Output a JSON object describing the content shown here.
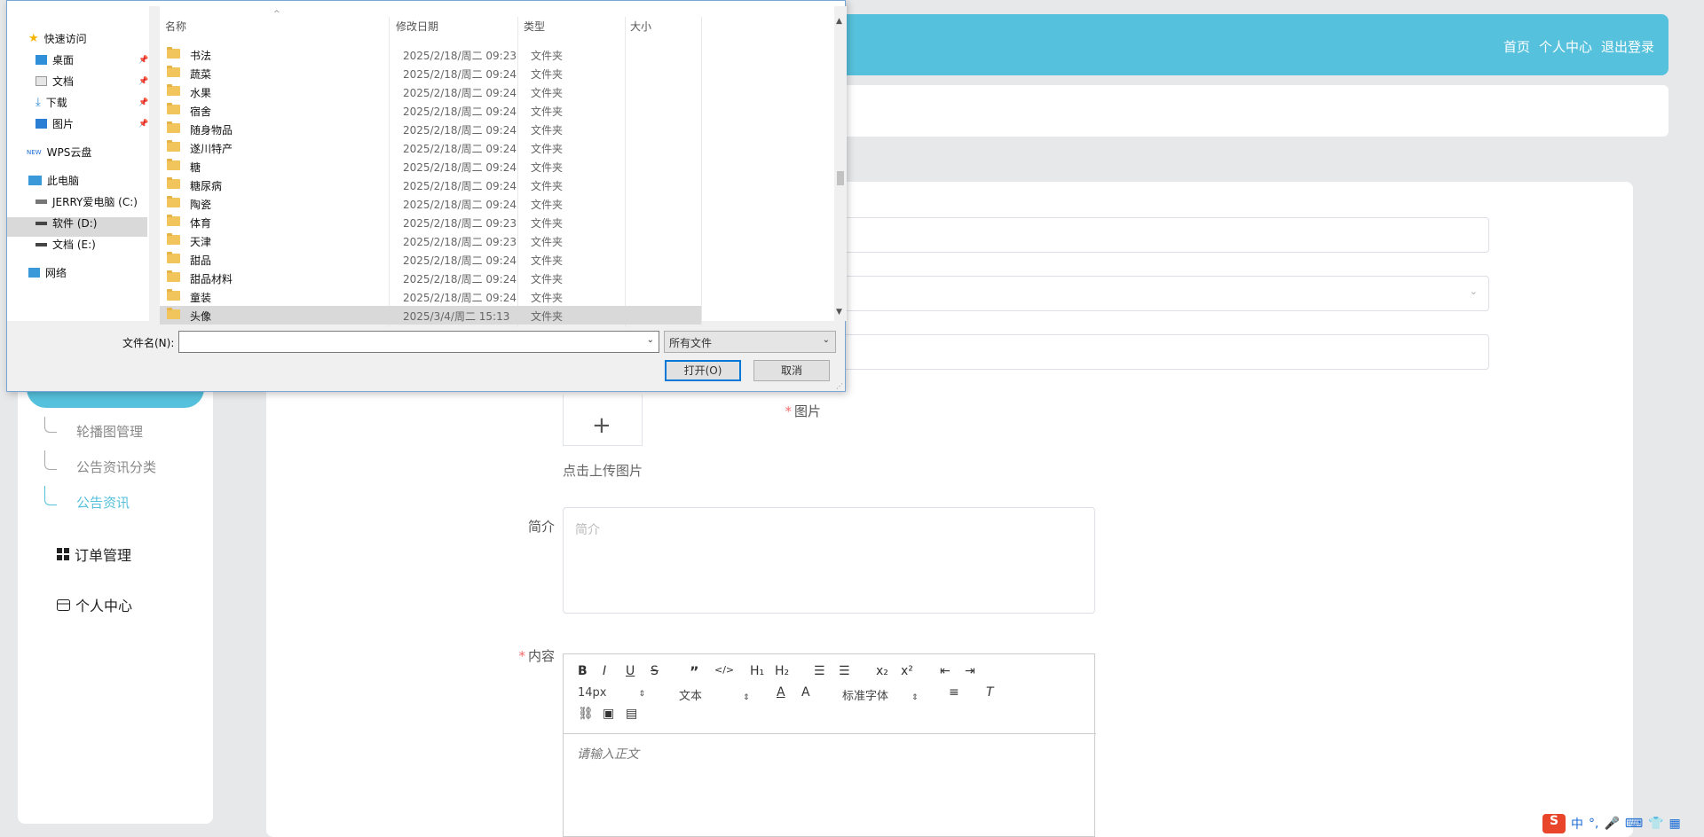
{
  "app": {
    "topnav": [
      "首页",
      "个人中心",
      "退出登录"
    ]
  },
  "sidebar": {
    "sub_items": [
      "轮播图管理",
      "公告资讯分类",
      "公告资讯"
    ],
    "menu": [
      "订单管理",
      "个人中心"
    ]
  },
  "form": {
    "image_label": "图片",
    "upload_tip": "点击上传图片",
    "intro_label": "简介",
    "intro_placeholder": "简介",
    "content_label": "内容",
    "editor": {
      "font_size": "14px",
      "heading": "文本",
      "font_family": "标准字体",
      "placeholder": "请输入正文"
    }
  },
  "dialog": {
    "nav": {
      "quick_access": "快速访问",
      "desktop": "桌面",
      "documents": "文档",
      "downloads": "下载",
      "pictures": "图片",
      "wps": "WPS云盘",
      "wps_badge": "NEW",
      "this_pc": "此电脑",
      "drive_c": "JERRY爱电脑 (C:)",
      "drive_d": "软件 (D:)",
      "drive_e": "文档 (E:)",
      "network": "网络"
    },
    "columns": [
      "名称",
      "修改日期",
      "类型",
      "大小"
    ],
    "rows": [
      {
        "name": "书法",
        "date": "2025/2/18/周二 09:23",
        "type": "文件夹"
      },
      {
        "name": "蔬菜",
        "date": "2025/2/18/周二 09:24",
        "type": "文件夹"
      },
      {
        "name": "水果",
        "date": "2025/2/18/周二 09:24",
        "type": "文件夹"
      },
      {
        "name": "宿舍",
        "date": "2025/2/18/周二 09:24",
        "type": "文件夹"
      },
      {
        "name": "随身物品",
        "date": "2025/2/18/周二 09:24",
        "type": "文件夹"
      },
      {
        "name": "遂川特产",
        "date": "2025/2/18/周二 09:24",
        "type": "文件夹"
      },
      {
        "name": "糖",
        "date": "2025/2/18/周二 09:24",
        "type": "文件夹"
      },
      {
        "name": "糖尿病",
        "date": "2025/2/18/周二 09:24",
        "type": "文件夹"
      },
      {
        "name": "陶瓷",
        "date": "2025/2/18/周二 09:24",
        "type": "文件夹"
      },
      {
        "name": "体育",
        "date": "2025/2/18/周二 09:23",
        "type": "文件夹"
      },
      {
        "name": "天津",
        "date": "2025/2/18/周二 09:23",
        "type": "文件夹"
      },
      {
        "name": "甜品",
        "date": "2025/2/18/周二 09:24",
        "type": "文件夹"
      },
      {
        "name": "甜品材料",
        "date": "2025/2/18/周二 09:24",
        "type": "文件夹"
      },
      {
        "name": "童装",
        "date": "2025/2/18/周二 09:24",
        "type": "文件夹"
      },
      {
        "name": "头像",
        "date": "2025/3/4/周二 15:13",
        "type": "文件夹"
      }
    ],
    "filename_label": "文件名(N):",
    "filename_value": "",
    "filter": "所有文件",
    "open_button": "打开(O)",
    "cancel_button": "取消"
  },
  "tray": {
    "ime_logo": "S",
    "ime_text": "中"
  }
}
